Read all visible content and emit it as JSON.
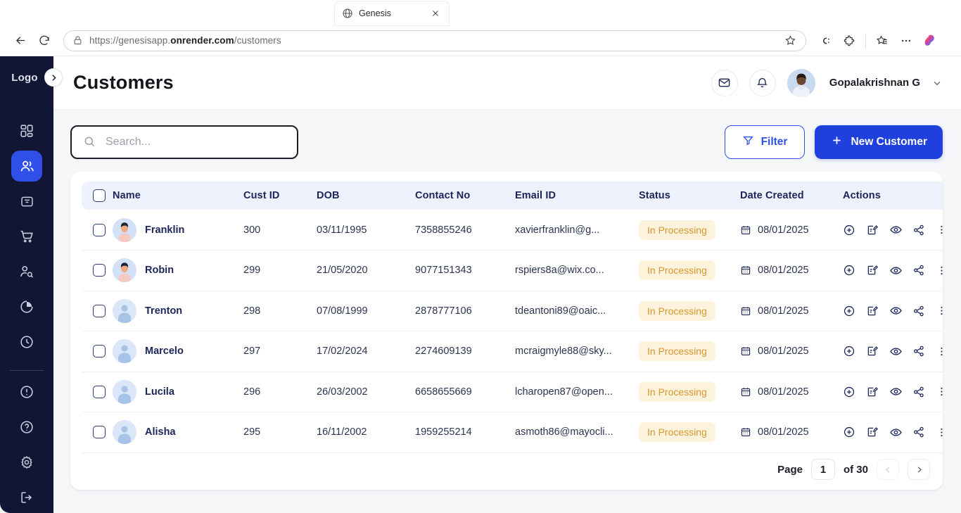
{
  "browser": {
    "tab": {
      "title": "Genesis",
      "favicon_icon": "globe-icon",
      "close_icon": "close-icon"
    },
    "back_icon": "back-arrow-icon",
    "reload_icon": "reload-icon",
    "lock_icon": "lock-icon",
    "url_prefix": "https://genesisapp.",
    "url_domain": "onrender.com",
    "url_path": "/customers",
    "bookmark_icon": "star-icon",
    "toolbar_icons": [
      "copilot-c-icon",
      "extensions-icon",
      "collections-icon",
      "more-icon",
      "copilot-icon"
    ]
  },
  "sidebar": {
    "logo_label": "Logo",
    "collapse_icon": "chevron-right-icon",
    "items": [
      {
        "name": "dashboard",
        "icon": "grid-icon",
        "active": false
      },
      {
        "name": "customers",
        "icon": "users-icon",
        "active": true
      },
      {
        "name": "inbox",
        "icon": "inbox-icon",
        "active": false
      },
      {
        "name": "orders",
        "icon": "cart-icon",
        "active": false
      },
      {
        "name": "user-search",
        "icon": "user-search-icon",
        "active": false
      },
      {
        "name": "reports",
        "icon": "pie-chart-icon",
        "active": false
      },
      {
        "name": "history",
        "icon": "clock-icon",
        "active": false
      }
    ],
    "bottom_items": [
      {
        "name": "alerts",
        "icon": "alert-circle-icon"
      },
      {
        "name": "help",
        "icon": "help-circle-icon"
      },
      {
        "name": "settings",
        "icon": "gear-icon"
      },
      {
        "name": "logout",
        "icon": "logout-icon"
      }
    ]
  },
  "header": {
    "title": "Customers",
    "mail_icon": "mail-icon",
    "bell_icon": "bell-icon",
    "avatar_icon": "avatar",
    "user_name": "Gopalakrishnan G",
    "chevron_icon": "chevron-down-icon"
  },
  "toolbar": {
    "search_placeholder": "Search...",
    "search_value": "",
    "search_icon": "search-icon",
    "filter_label": "Filter",
    "filter_icon": "funnel-icon",
    "new_customer_label": "New Customer",
    "new_customer_icon": "plus-icon"
  },
  "table": {
    "columns": [
      "Name",
      "Cust ID",
      "DOB",
      "Contact No",
      "Email ID",
      "Status",
      "Date Created",
      "Actions"
    ],
    "action_icons": [
      "add-circle-icon",
      "edit-note-icon",
      "eye-icon",
      "share-icon",
      "more-vertical-icon"
    ],
    "calendar_icon": "calendar-icon",
    "rows": [
      {
        "name": "Franklin",
        "cust_id": "300",
        "dob": "03/11/1995",
        "contact": "7358855246",
        "email": "xavierfranklin@g...",
        "status": "In Processing",
        "date": "08/01/2025",
        "avatar_type": "photo"
      },
      {
        "name": "Robin",
        "cust_id": "299",
        "dob": "21/05/2020",
        "contact": "9077151343",
        "email": "rspiers8a@wix.co...",
        "status": "In Processing",
        "date": "08/01/2025",
        "avatar_type": "photo"
      },
      {
        "name": "Trenton",
        "cust_id": "298",
        "dob": "07/08/1999",
        "contact": "2878777106",
        "email": "tdeantoni89@oaic...",
        "status": "In Processing",
        "date": "08/01/2025",
        "avatar_type": "placeholder"
      },
      {
        "name": "Marcelo",
        "cust_id": "297",
        "dob": "17/02/2024",
        "contact": "2274609139",
        "email": "mcraigmyle88@sky...",
        "status": "In Processing",
        "date": "08/01/2025",
        "avatar_type": "placeholder"
      },
      {
        "name": "Lucila",
        "cust_id": "296",
        "dob": "26/03/2002",
        "contact": "6658655669",
        "email": "lcharopen87@open...",
        "status": "In Processing",
        "date": "08/01/2025",
        "avatar_type": "placeholder"
      },
      {
        "name": "Alisha",
        "cust_id": "295",
        "dob": "16/11/2002",
        "contact": "1959255214",
        "email": "asmoth86@mayocli...",
        "status": "In Processing",
        "date": "08/01/2025",
        "avatar_type": "placeholder"
      }
    ]
  },
  "pagination": {
    "page_label": "Page",
    "current_page": "1",
    "of_label": "of 30",
    "prev_icon": "chevron-left-icon",
    "next_icon": "chevron-right-icon"
  },
  "colors": {
    "sidebar_bg": "#111634",
    "accent_blue": "#2f4fe8",
    "primary_button": "#1f40dd",
    "table_header_bg": "#eef2fd",
    "status_bg": "#fdf3dd",
    "status_text": "#d9962c",
    "page_bg": "#f5f6f8",
    "text_dark": "#1b2559"
  }
}
